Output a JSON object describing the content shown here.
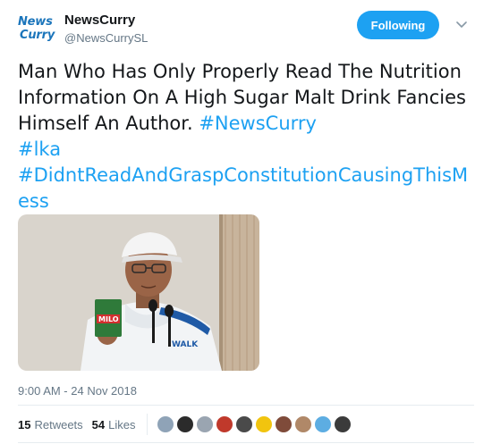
{
  "account": {
    "avatar_text_line1": "News",
    "avatar_text_line2": "Curry",
    "display_name": "NewsCurry",
    "handle": "@NewsCurrySL"
  },
  "follow_button": {
    "label": "Following"
  },
  "tweet": {
    "text_plain": "Man Who Has Only Properly Read The Nutrition Information On A High Sugar Malt Drink Fancies Himself An Author. ",
    "hashtags": [
      "#NewsCurry",
      "#lka",
      "#DidntReadAndGraspConstitutionCausingThisMess"
    ],
    "timestamp": "9:00 AM - 24 Nov 2018"
  },
  "stats": {
    "retweets_count": "15",
    "retweets_label": "Retweets",
    "likes_count": "54",
    "likes_label": "Likes"
  },
  "colors": {
    "accent": "#1da1f2",
    "brand_blue": "#1b75bb",
    "secondary_text": "#657786",
    "divider": "#e6ecf0"
  },
  "icons": [
    "chevron-down-icon"
  ]
}
